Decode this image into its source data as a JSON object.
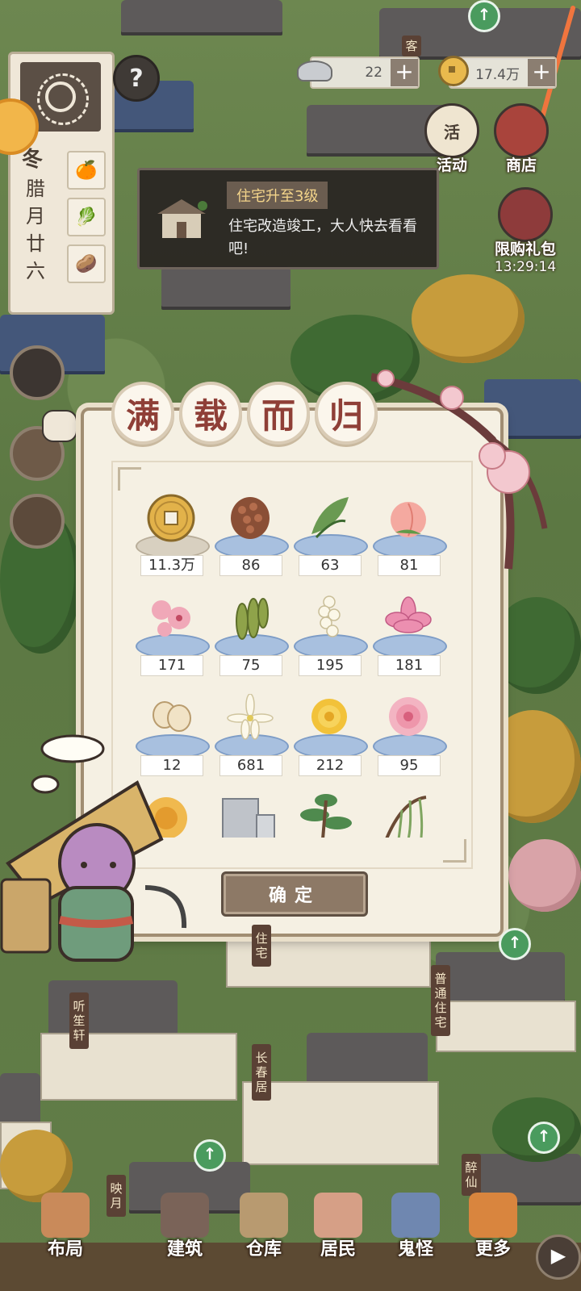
{
  "header": {
    "season": "冬",
    "lunar_date": "腊月廿六",
    "silver": {
      "value": "22",
      "plus": "+"
    },
    "copper": {
      "value": "17.4万",
      "plus": "+"
    },
    "help": "?"
  },
  "right_buttons": {
    "activity": "活动",
    "activity_badge": "活",
    "shop": "商店",
    "limited_gift": "限购礼包",
    "limited_timer": "13:29:14"
  },
  "notice": {
    "title": "住宅升至3级",
    "body": "住宅改造竣工，大人快去看看吧!"
  },
  "dialog": {
    "title_chars": [
      "满",
      "载",
      "而",
      "归"
    ],
    "items": [
      {
        "name": "coin",
        "count": "11.3万"
      },
      {
        "name": "pinecone",
        "count": "86"
      },
      {
        "name": "leaves",
        "count": "63"
      },
      {
        "name": "peach",
        "count": "81"
      },
      {
        "name": "peach-blossom",
        "count": "171"
      },
      {
        "name": "bean-pods",
        "count": "75"
      },
      {
        "name": "white-blossom",
        "count": "195"
      },
      {
        "name": "lotus",
        "count": "181"
      },
      {
        "name": "lotus-seeds",
        "count": "12"
      },
      {
        "name": "orchid",
        "count": "681"
      },
      {
        "name": "chrysanthemum",
        "count": "212"
      },
      {
        "name": "peony",
        "count": "95"
      },
      {
        "name": "yellow-rose",
        "count": ""
      },
      {
        "name": "stone",
        "count": ""
      },
      {
        "name": "bonsai",
        "count": ""
      },
      {
        "name": "willow",
        "count": ""
      }
    ],
    "confirm": "确定"
  },
  "buildings": {
    "tingsheng": "听笙轩",
    "changchun": "长春居",
    "putong": "普通住宅",
    "zhuzhai": "住宅",
    "yingyue": "映月",
    "zuixian": "醉仙",
    "ke": "客"
  },
  "nav": {
    "layout": "布局",
    "build": "建筑",
    "warehouse": "仓库",
    "residents": "居民",
    "ghosts": "鬼怪",
    "more": "更多",
    "next": "▶"
  },
  "colors": {
    "title_red": "#8f3f37",
    "dialog_bg": "#f5f0e3",
    "plate_blue": "#a8c0df",
    "upgrade_green": "#4a9b5e"
  }
}
